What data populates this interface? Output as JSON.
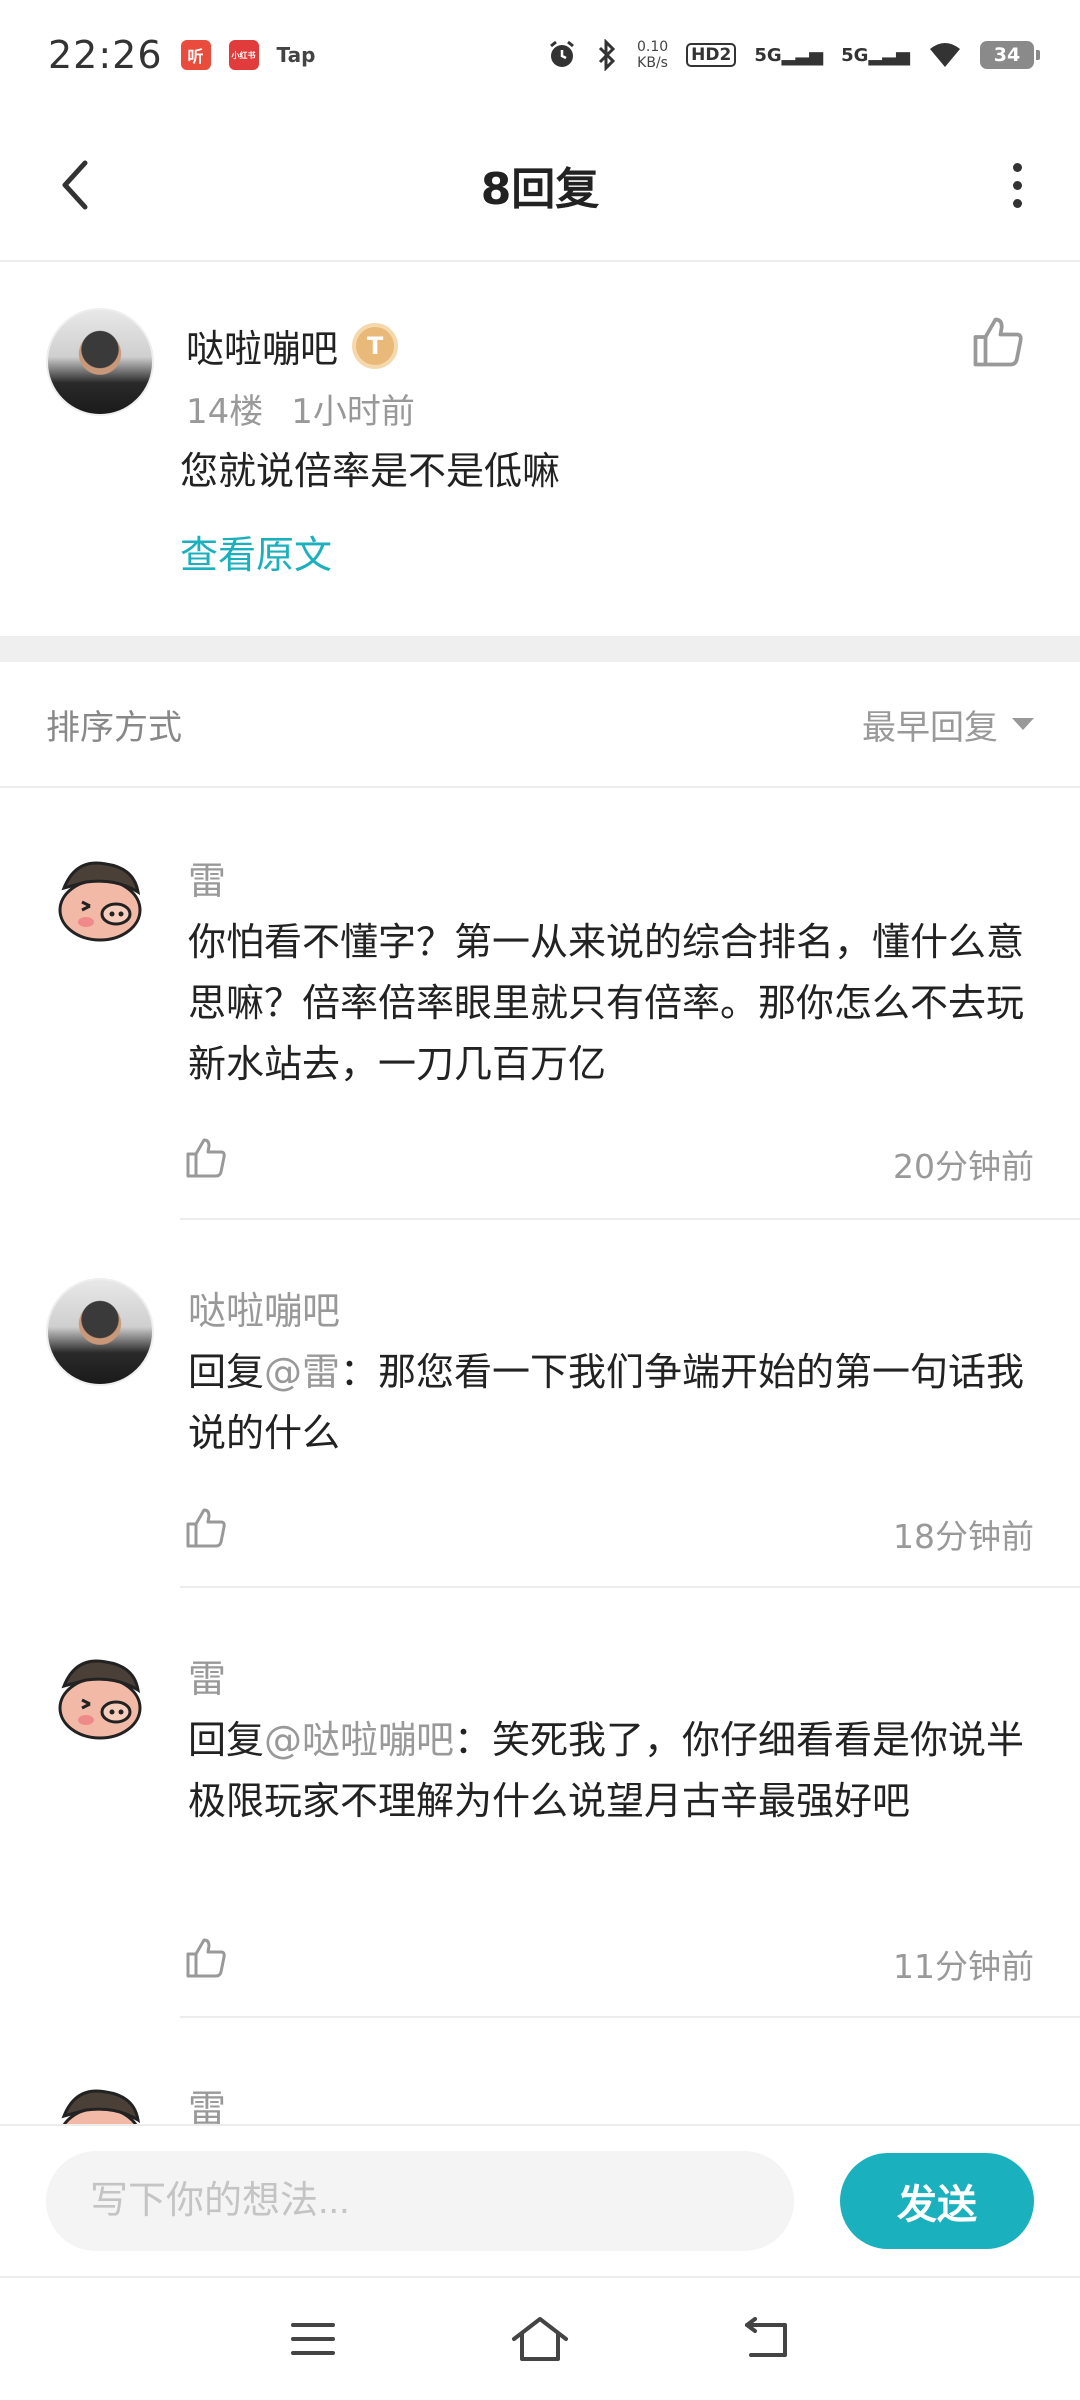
{
  "status_bar": {
    "time": "22:26",
    "app_badge_1": "听",
    "app_badge_2": "小红书",
    "app_badge_3": "Tap",
    "net_speed_value": "0.10",
    "net_speed_unit": "KB/s",
    "hd_label": "HD2",
    "sim1": "5G",
    "sim2": "5G",
    "battery": "34"
  },
  "header": {
    "title": "8回复"
  },
  "original_post": {
    "username": "哒啦嘣吧",
    "level_badge": "T",
    "floor": "14楼",
    "time": "1小时前",
    "content": "您就说倍率是不是低嘛",
    "view_original": "查看原文"
  },
  "sort": {
    "label": "排序方式",
    "selected": "最早回复"
  },
  "replies": [
    {
      "username": "雷",
      "mention": "",
      "text": "你怕看不懂字？第一从来说的综合排名，懂什么意思嘛？倍率倍率眼里就只有倍率。那你怎么不去玩新水站去，一刀几百万亿",
      "time": "20分钟前"
    },
    {
      "username": "哒啦嘣吧",
      "prefix": "回复",
      "mention": "@雷",
      "text": "：那您看一下我们争端开始的第一句话我说的什么",
      "time": "18分钟前"
    },
    {
      "username": "雷",
      "prefix": "回复",
      "mention": "@哒啦嘣吧",
      "text": "：笑死我了，你仔细看看是你说半极限玩家不理解为什么说望月古辛最强好吧",
      "time": "11分钟前"
    },
    {
      "username": "雷"
    }
  ],
  "composer": {
    "placeholder": "写下你的想法...",
    "send_label": "发送"
  },
  "colors": {
    "accent": "#1ab0bd",
    "muted_text": "#999999",
    "primary_text": "#222222"
  }
}
